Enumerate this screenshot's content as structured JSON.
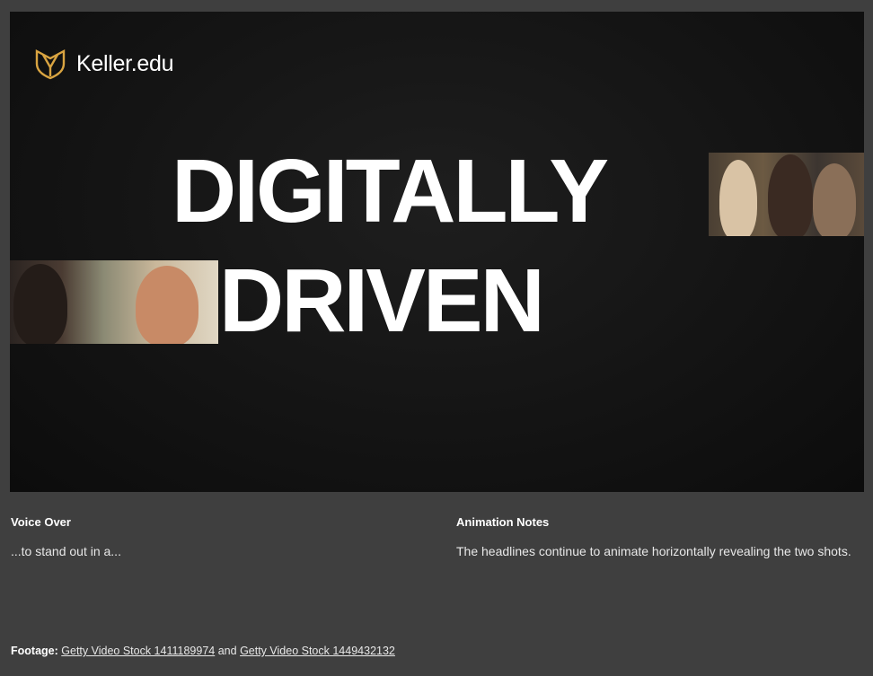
{
  "brand": {
    "name": "Keller.edu",
    "accent": "#d9a441"
  },
  "slide": {
    "headline_line1": "DIGITALLY",
    "headline_line2": "DRIVEN"
  },
  "voice_over": {
    "title": "Voice Over",
    "text": "...to stand out in a..."
  },
  "animation_notes": {
    "title": "Animation Notes",
    "text": "The headlines continue to animate horizontally revealing the two shots."
  },
  "footage": {
    "label": "Footage:",
    "link1": "Getty Video Stock 1411189974",
    "joiner": "and",
    "link2": "Getty Video Stock 1449432132"
  }
}
